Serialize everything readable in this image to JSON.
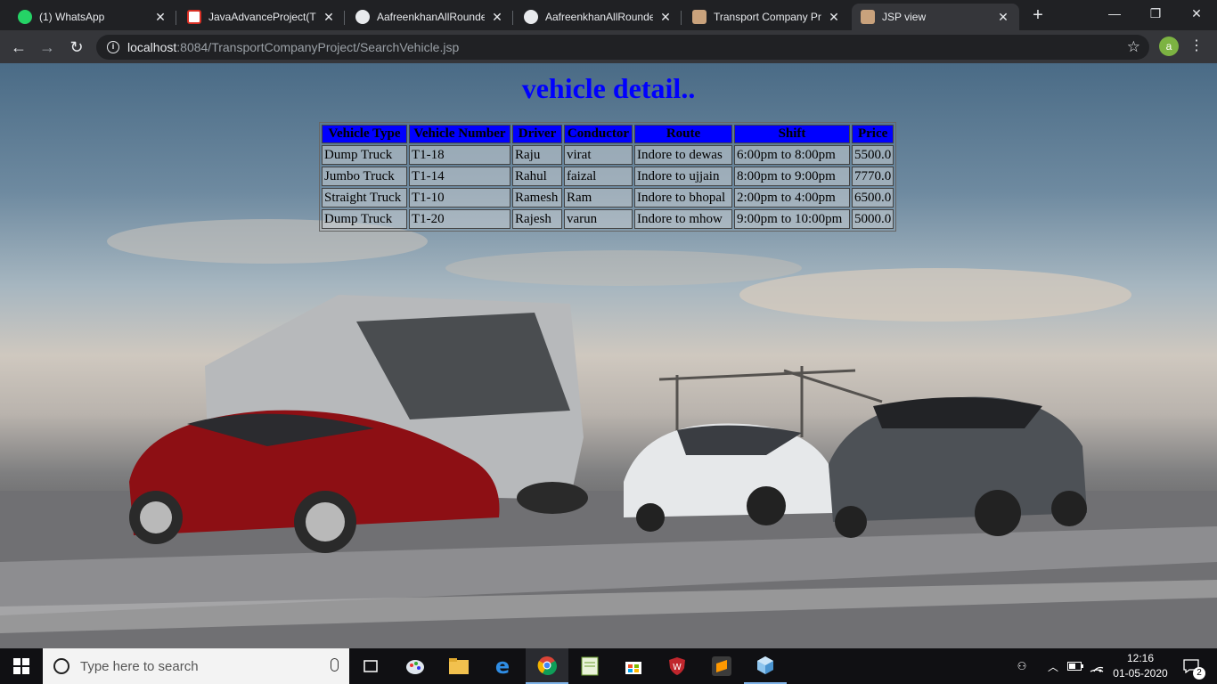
{
  "browser": {
    "tabs": [
      {
        "label": "(1) WhatsApp",
        "icon": "whatsapp-icon",
        "active": false
      },
      {
        "label": "JavaAdvanceProject(Tra",
        "icon": "gmail-icon",
        "active": false
      },
      {
        "label": "AafreenkhanAllRounder",
        "icon": "github-icon",
        "active": false
      },
      {
        "label": "AafreenkhanAllRounder",
        "icon": "github-icon",
        "active": false
      },
      {
        "label": "Transport Company Pro",
        "icon": "site-icon",
        "active": false
      },
      {
        "label": "JSP view",
        "icon": "site-icon",
        "active": true
      }
    ],
    "url_host": "localhost",
    "url_path": ":8084/TransportCompanyProject/SearchVehicle.jsp",
    "profile_initial": "a"
  },
  "page": {
    "heading": "vehicle detail..",
    "table": {
      "headers": [
        "Vehicle Type",
        "Vehicle Number",
        "Driver",
        "Conductor",
        "Route",
        "Shift",
        "Price"
      ],
      "rows": [
        [
          "Dump Truck",
          "T1-18",
          "Raju",
          "virat",
          "Indore to dewas",
          "6:00pm to 8:00pm",
          "5500.0"
        ],
        [
          "Jumbo Truck",
          "T1-14",
          "Rahul",
          "faizal",
          "Indore to ujjain",
          "8:00pm to 9:00pm",
          "7770.0"
        ],
        [
          "Straight Truck",
          "T1-10",
          "Ramesh",
          "Ram",
          "Indore to bhopal",
          "2:00pm to 4:00pm",
          "6500.0"
        ],
        [
          "Dump Truck",
          "T1-20",
          "Rajesh",
          "varun",
          "Indore to mhow",
          "9:00pm to 10:00pm",
          "5000.0"
        ]
      ]
    }
  },
  "taskbar": {
    "search_placeholder": "Type here to search",
    "time": "12:16",
    "date": "01-05-2020",
    "notification_count": "2"
  }
}
